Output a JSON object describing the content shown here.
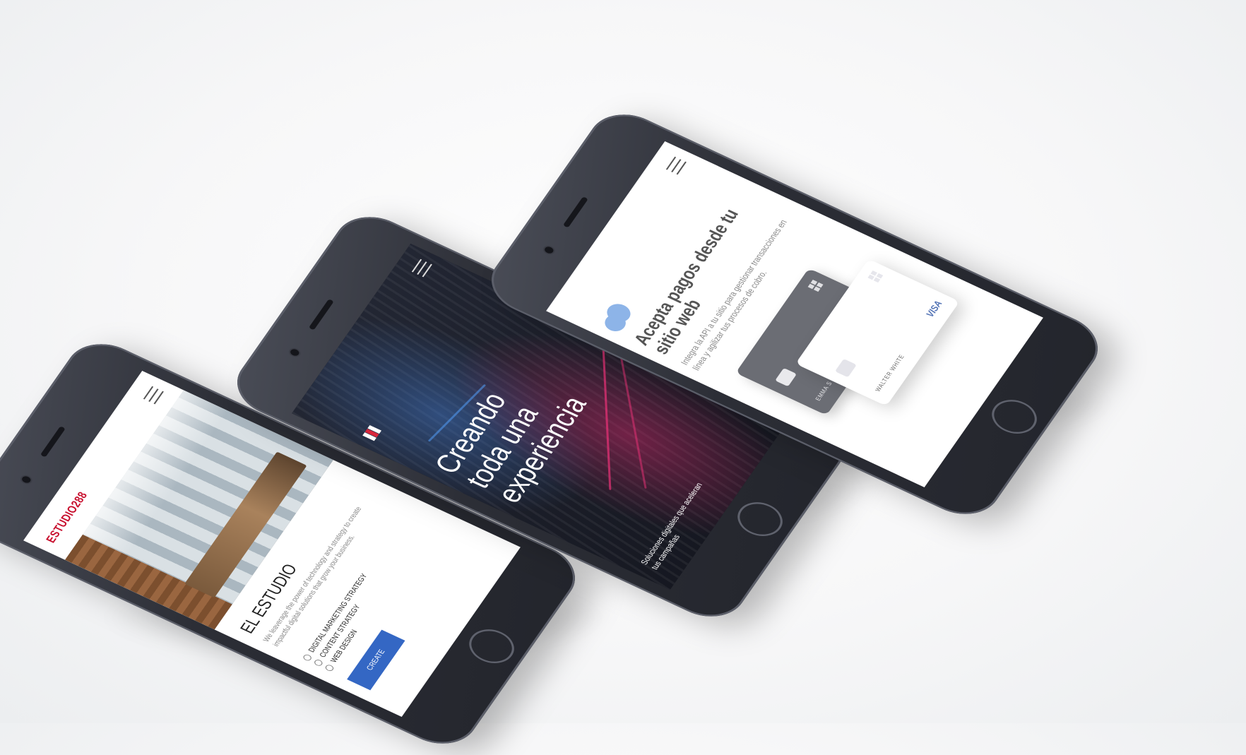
{
  "phones": [
    {
      "id": "estudio",
      "brand": "ESTUDIO288",
      "section_title": "EL ESTUDIO",
      "description": "We leaverage the power of technology and strategy to create impactful digital solutions that grow your business.",
      "services": [
        "DIGITAL MARKETING STRATEGY",
        "CONTENT STRATEGY",
        "WEB DESIGN"
      ],
      "button_label": "CREATE",
      "accent_color": "#c8102e",
      "button_color": "#3467c4",
      "icons": [
        "menu-icon"
      ]
    },
    {
      "id": "experiencia",
      "headline_lines": [
        "Creando",
        "toda una",
        "experiencia"
      ],
      "subtitle": "Soluciones digitales que aceleran tus campañas",
      "icons": [
        "menu-icon",
        "flag-logo-icon"
      ]
    },
    {
      "id": "pagos",
      "title": "Acepta pagos desde tu sitio web",
      "description": "Integra la API a tu sitio para gestionar transacciones en línea y agilizar tus procesos de cobro.",
      "cards": [
        {
          "holder": "EMMA S",
          "style": "dark",
          "brand_icon": "windows-icon"
        },
        {
          "holder": "WALTER WHITE",
          "style": "light",
          "brand": "VISA"
        }
      ],
      "accent_color": "#8db4e8",
      "icons": [
        "menu-icon",
        "cloud-logo-icon"
      ]
    }
  ]
}
